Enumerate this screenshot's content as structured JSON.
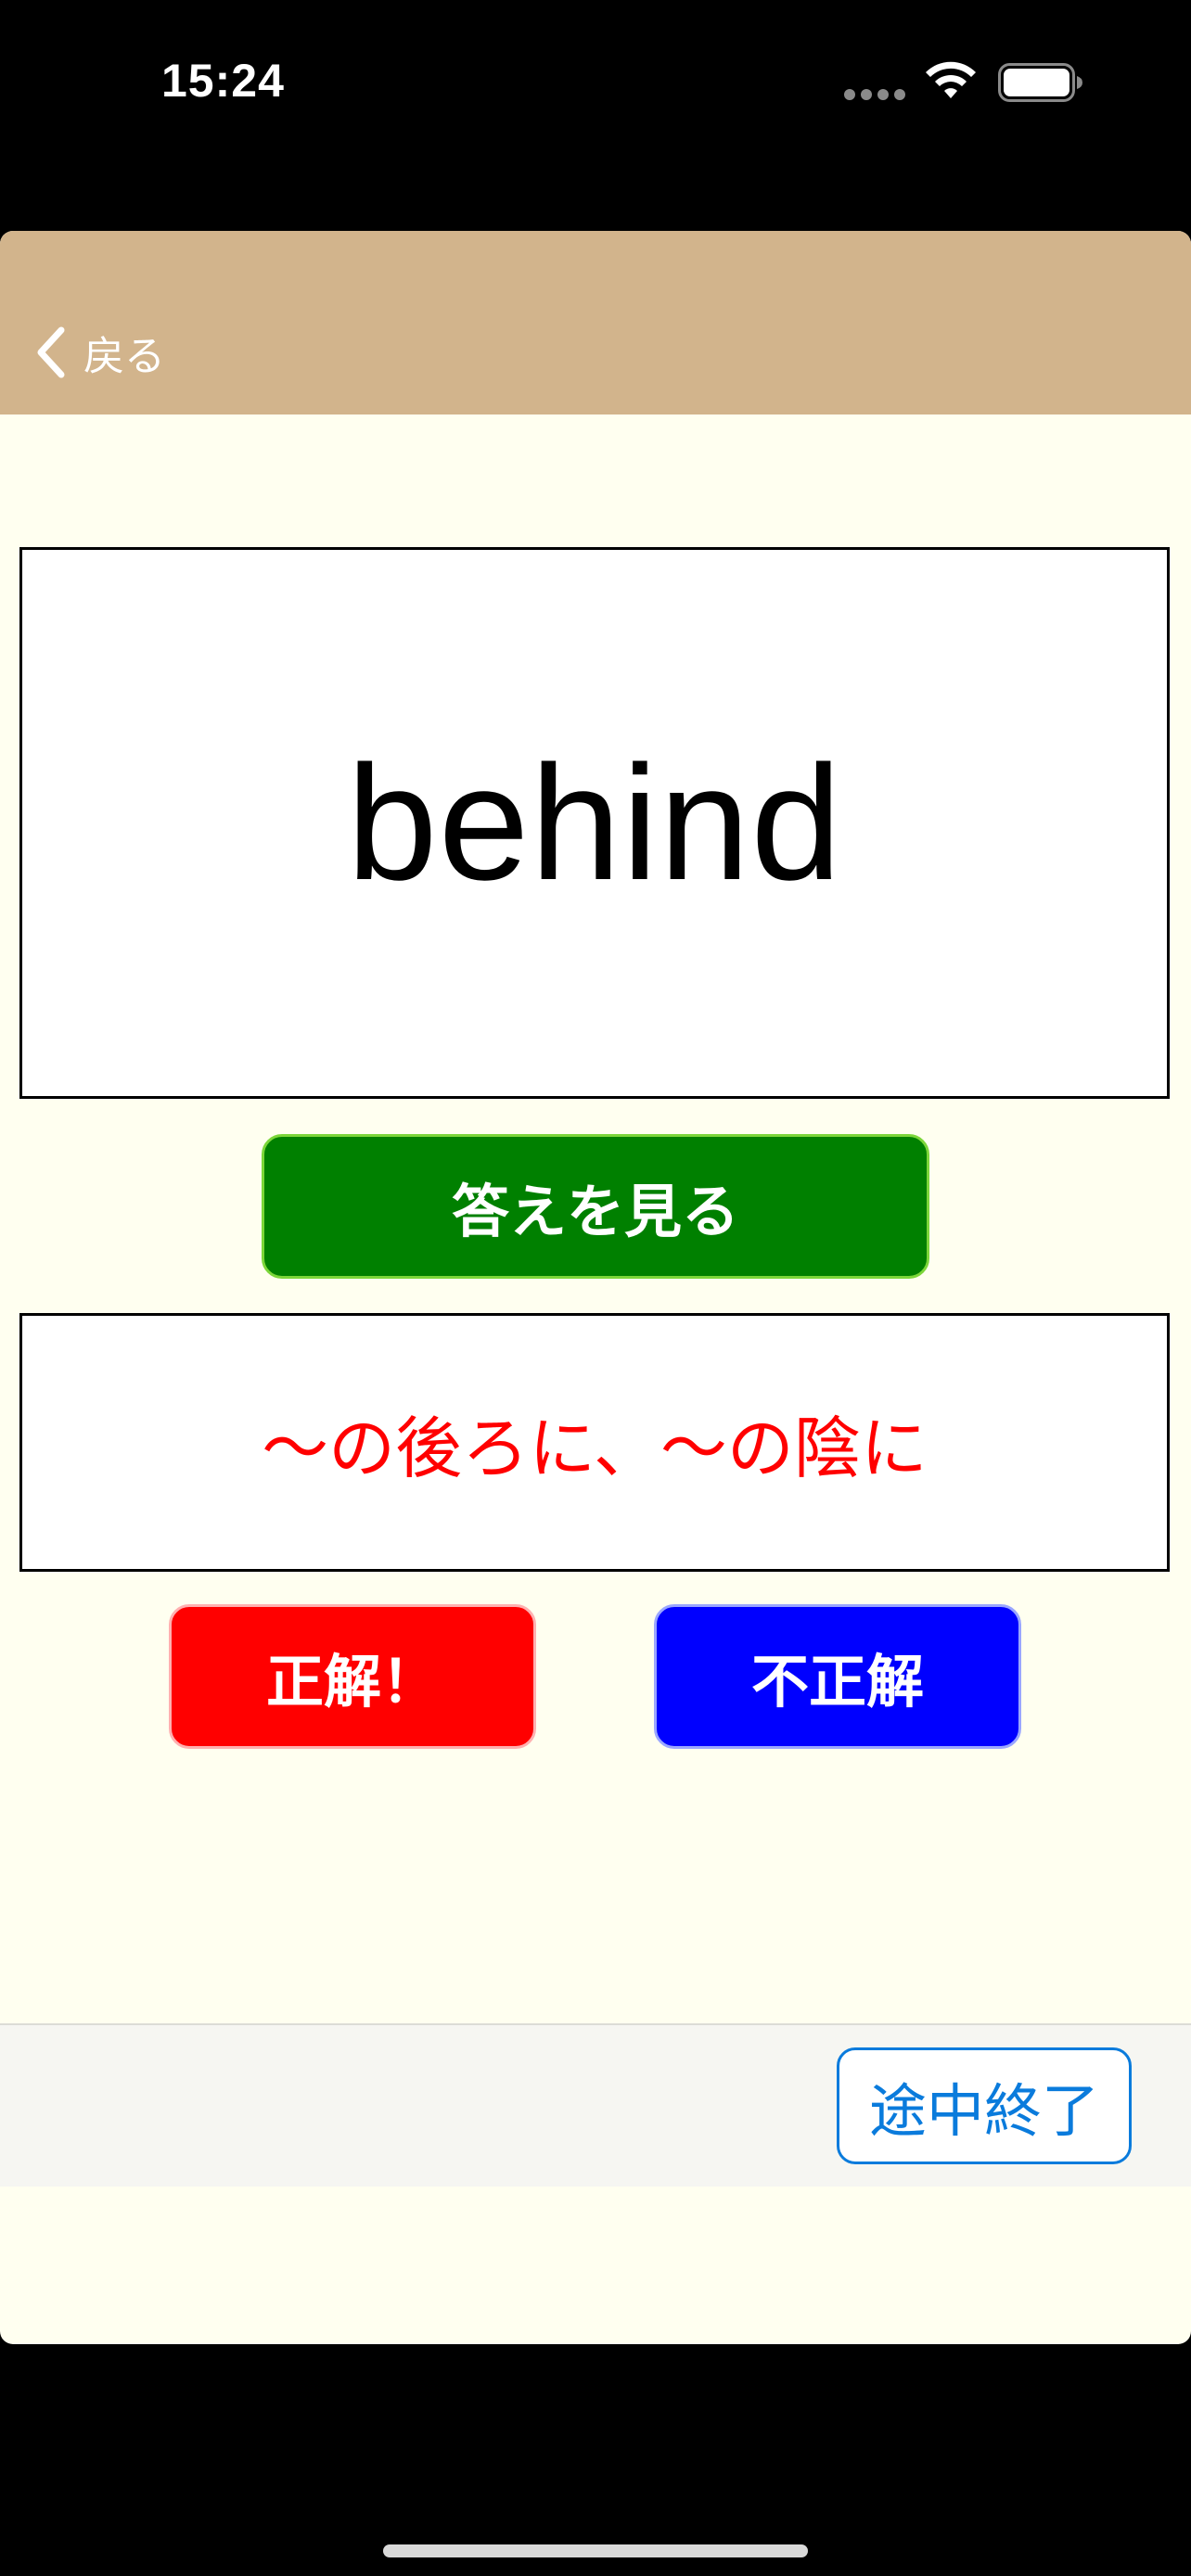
{
  "status_bar": {
    "time": "15:24"
  },
  "nav": {
    "back_label": "戻る"
  },
  "card": {
    "word": "behind"
  },
  "show_answer_label": "答えを見る",
  "answer": {
    "meaning": "〜の後ろに、〜の陰に"
  },
  "judge": {
    "correct_label": "正解！",
    "incorrect_label": "不正解"
  },
  "toolbar": {
    "quit_label": "途中終了"
  },
  "colors": {
    "nav_background": "#d2b48c",
    "page_background": "#fffff0",
    "show_answer_button": "#008000",
    "correct_button": "#ff0000",
    "incorrect_button": "#0000ff",
    "answer_text": "#ff0000",
    "quit_button_accent": "#0a7bdc"
  },
  "icons": {
    "back": "chevron-left-icon",
    "wifi": "wifi-icon",
    "battery": "battery-icon",
    "cellular": "cellular-dots-icon"
  }
}
